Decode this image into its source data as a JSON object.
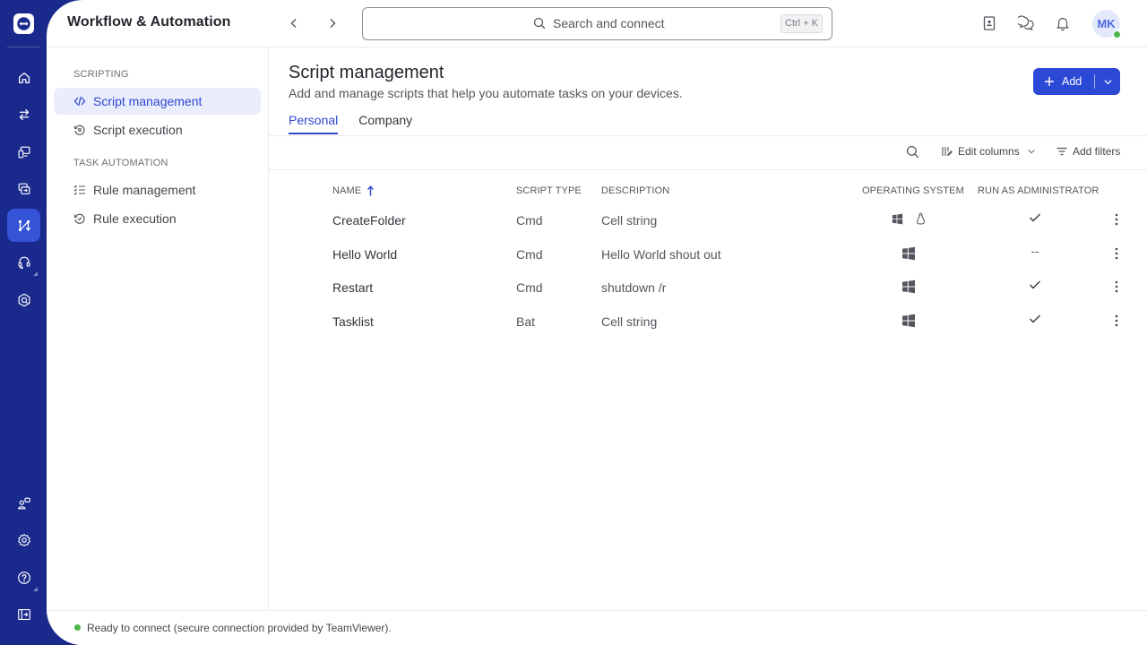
{
  "app": {
    "title": "Workflow & Automation",
    "brand_color": "#1a2a8c",
    "accent_color": "#2c49d6"
  },
  "rail": {
    "items": [
      {
        "icon": "home-icon",
        "label": "Home"
      },
      {
        "icon": "transfer-icon",
        "label": "Remote connections"
      },
      {
        "icon": "devices-icon",
        "label": "Devices"
      },
      {
        "icon": "sessions-icon",
        "label": "Sessions"
      },
      {
        "icon": "workflow-icon",
        "label": "Workflow & Automation",
        "active": true
      },
      {
        "icon": "headset-icon",
        "label": "Support"
      },
      {
        "icon": "security-icon",
        "label": "Security"
      }
    ],
    "bottom_items": [
      {
        "icon": "community-icon",
        "label": "Community"
      },
      {
        "icon": "settings-icon",
        "label": "Settings"
      },
      {
        "icon": "help-icon",
        "label": "Help"
      },
      {
        "icon": "collapse-panel-icon",
        "label": "Collapse"
      }
    ]
  },
  "topbar": {
    "search_placeholder": "Search and connect",
    "search_shortcut": "Ctrl + K",
    "avatar_initials": "MK",
    "status": "online"
  },
  "subnav": {
    "sections": [
      {
        "title": "SCRIPTING",
        "items": [
          {
            "label": "Script management",
            "icon": "code-icon",
            "active": true
          },
          {
            "label": "Script execution",
            "icon": "history-icon"
          }
        ]
      },
      {
        "title": "TASK AUTOMATION",
        "items": [
          {
            "label": "Rule management",
            "icon": "checklist-icon"
          },
          {
            "label": "Rule execution",
            "icon": "history-check-icon"
          }
        ]
      }
    ]
  },
  "page": {
    "title": "Script management",
    "subtitle": "Add and manage scripts that help you automate tasks on your devices.",
    "add_label": "Add",
    "tabs": [
      {
        "label": "Personal",
        "active": true
      },
      {
        "label": "Company"
      }
    ],
    "toolbar": {
      "edit_columns": "Edit columns",
      "add_filters": "Add filters"
    }
  },
  "table": {
    "columns": [
      "NAME",
      "SCRIPT TYPE",
      "DESCRIPTION",
      "OPERATING SYSTEM",
      "RUN AS ADMINISTRATOR"
    ],
    "sort": {
      "column": "NAME",
      "direction": "ascending"
    },
    "rows": [
      {
        "name": "CreateFolder",
        "type": "Cmd",
        "description": "Cell string",
        "os": [
          "windows",
          "linux"
        ],
        "admin": true
      },
      {
        "name": "Hello World",
        "type": "Cmd",
        "description": "Hello World shout out",
        "os": [
          "windows"
        ],
        "admin": false,
        "admin_text": "--"
      },
      {
        "name": "Restart",
        "type": "Cmd",
        "description": "shutdown /r",
        "os": [
          "windows"
        ],
        "admin": true
      },
      {
        "name": "Tasklist",
        "type": "Bat",
        "description": "Cell string",
        "os": [
          "windows"
        ],
        "admin": true
      }
    ]
  },
  "status": {
    "text": "Ready to connect (secure connection provided by TeamViewer)."
  }
}
